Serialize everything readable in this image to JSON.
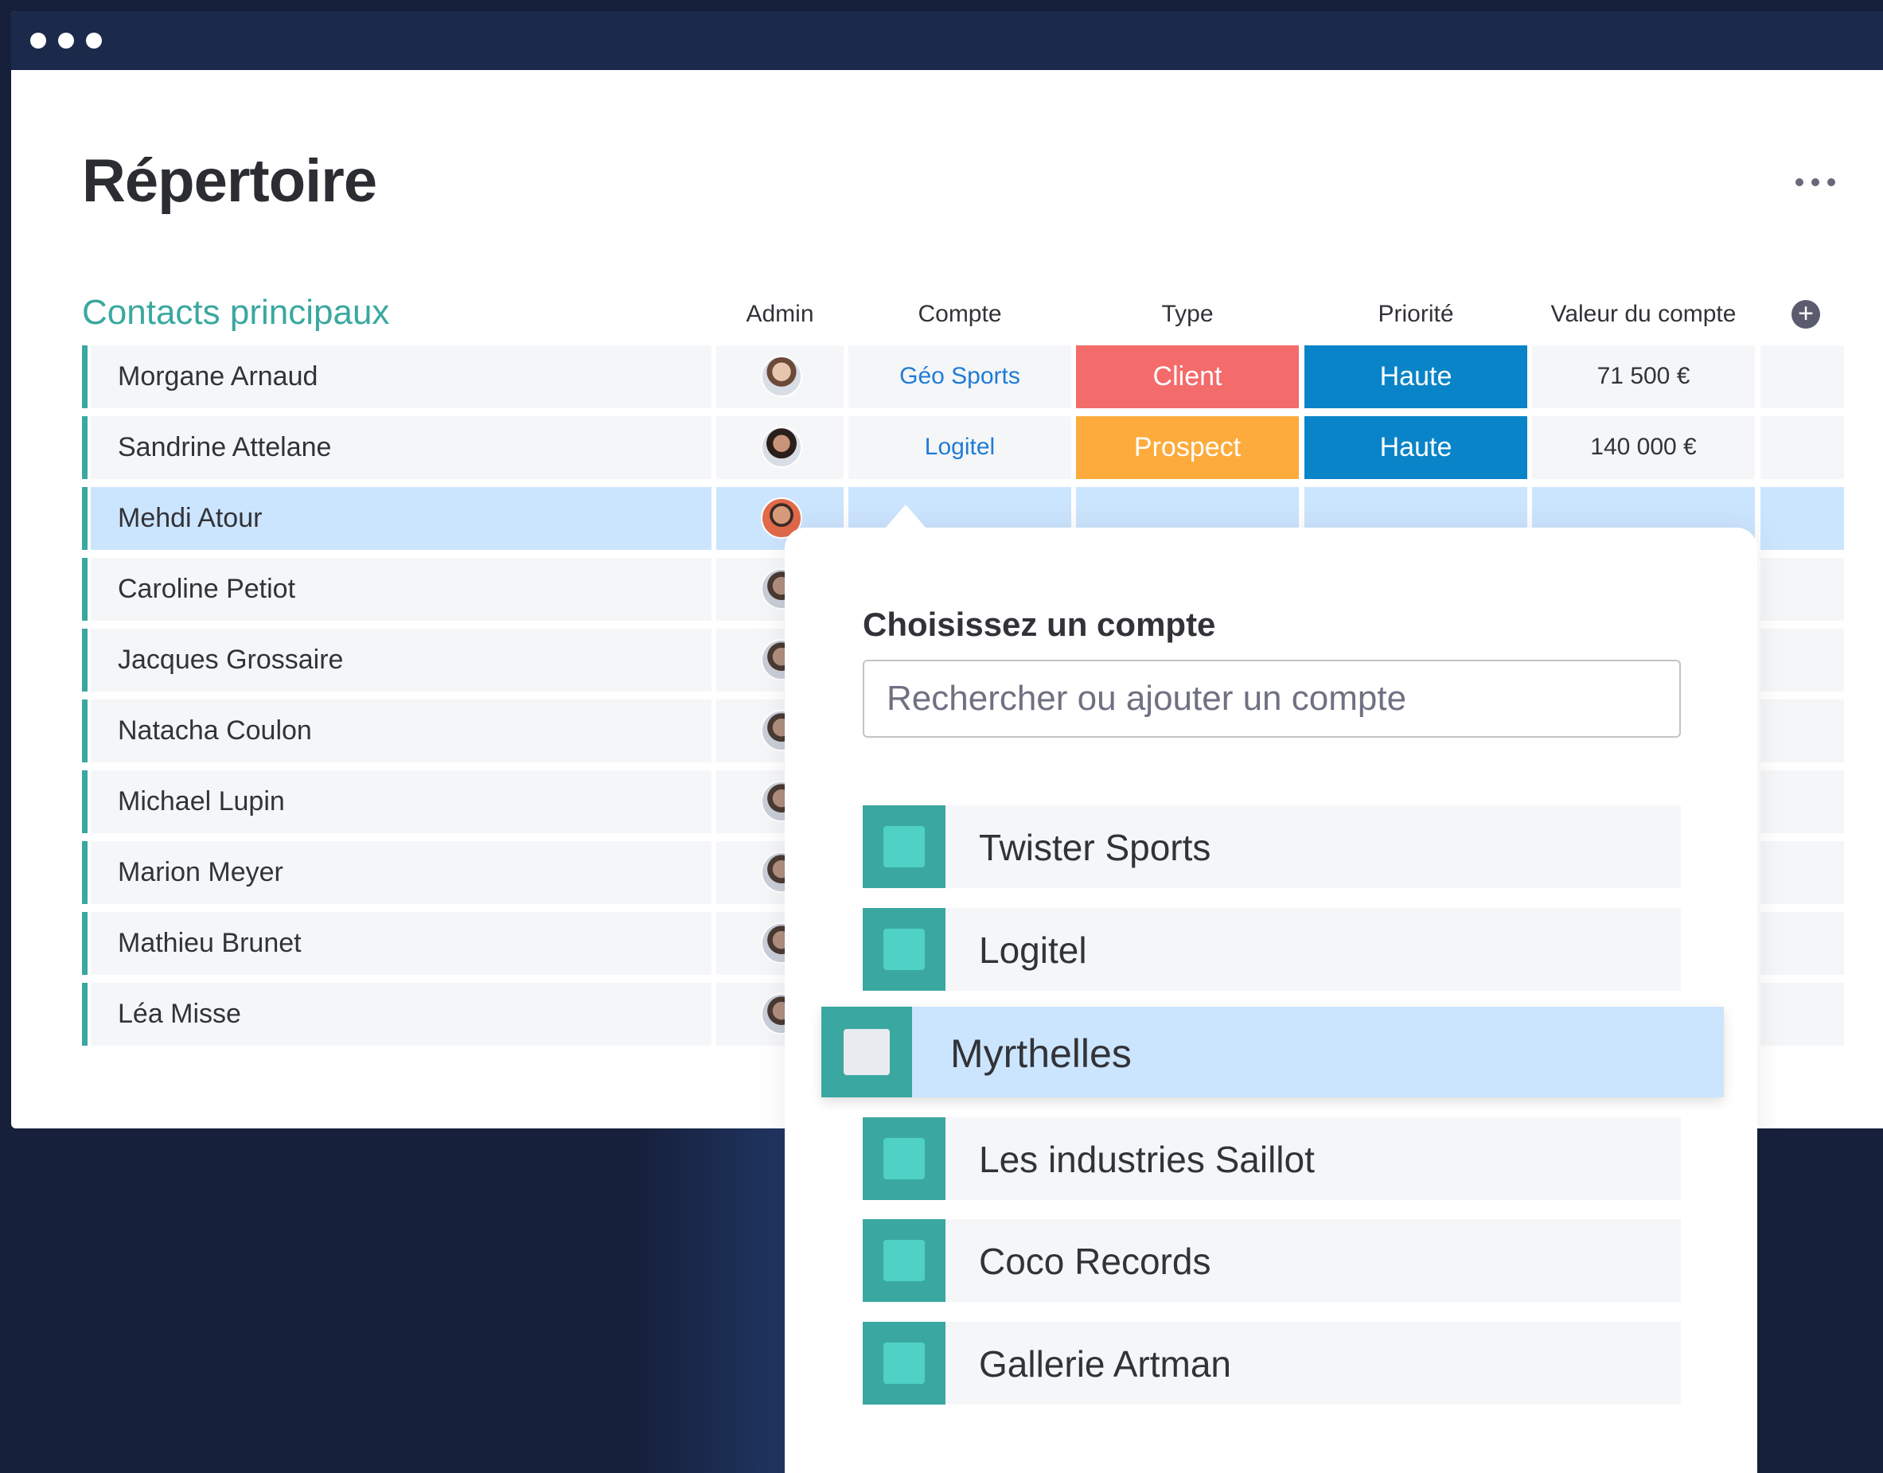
{
  "page": {
    "title": "Répertoire"
  },
  "group": {
    "title": "Contacts principaux"
  },
  "columns": {
    "admin": "Admin",
    "compte": "Compte",
    "type": "Type",
    "priorite": "Priorité",
    "valeur": "Valeur du compte"
  },
  "icons": {
    "more": "more-horizontal-icon",
    "add": "plus-circle-icon"
  },
  "colors": {
    "accent": "#3aa8a0",
    "client": "#f36b6b",
    "prospect": "#fdab3d",
    "haute": "#0a84c8",
    "link": "#1e7cd6",
    "selected": "#cce5ff"
  },
  "rows": [
    {
      "name": "Morgane Arnaud",
      "compte": "Géo Sports",
      "type": "Client",
      "priorite": "Haute",
      "valeur": "71 500 €"
    },
    {
      "name": "Sandrine Attelane",
      "compte": "Logitel",
      "type": "Prospect",
      "priorite": "Haute",
      "valeur": "140 000 €"
    },
    {
      "name": "Mehdi Atour",
      "compte": "",
      "type": "",
      "priorite": "",
      "valeur": ""
    },
    {
      "name": "Caroline Petiot"
    },
    {
      "name": "Jacques Grossaire"
    },
    {
      "name": "Natacha Coulon"
    },
    {
      "name": "Michael Lupin"
    },
    {
      "name": "Marion Meyer"
    },
    {
      "name": "Mathieu Brunet"
    },
    {
      "name": "Léa Misse"
    }
  ],
  "dropdown": {
    "title": "Choisissez un compte",
    "search_placeholder": "Rechercher ou ajouter un compte",
    "options": [
      "Twister Sports",
      "Logitel",
      "Myrthelles",
      "Les industries Saillot",
      "Coco Records",
      "Gallerie Artman"
    ],
    "highlighted": "Myrthelles"
  }
}
